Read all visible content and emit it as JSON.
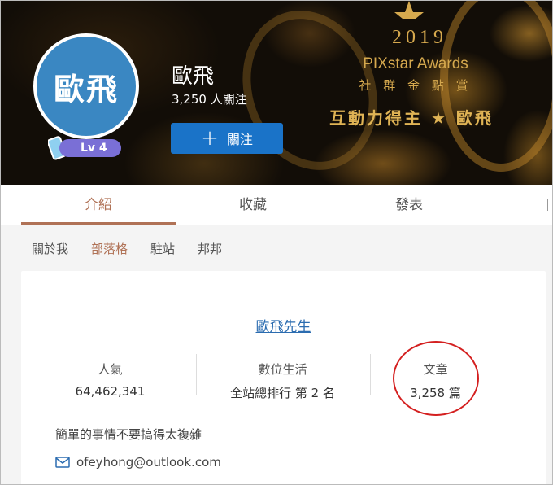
{
  "banner": {
    "award_year": "2019",
    "award_name": "PIXstar Awards",
    "award_category": "社 群 金 點 賞",
    "award_line": "互動力得主 ★ 歐飛"
  },
  "profile": {
    "avatar_text": "歐飛",
    "level": "Lv 4",
    "name": "歐飛",
    "followers": "3,250 人關注",
    "follow_label": "關注"
  },
  "tabs": [
    {
      "label": "介紹",
      "active": true
    },
    {
      "label": "收藏",
      "active": false
    },
    {
      "label": "發表",
      "active": false
    }
  ],
  "subnav": [
    {
      "label": "關於我",
      "active": false
    },
    {
      "label": "部落格",
      "active": true
    },
    {
      "label": "駐站",
      "active": false
    },
    {
      "label": "邦邦",
      "active": false
    }
  ],
  "card": {
    "site_title": "歐飛先生",
    "stats": [
      {
        "label": "人氣",
        "value": "64,462,341"
      },
      {
        "label": "數位生活",
        "value": "全站總排行 第 2 名"
      },
      {
        "label": "文章",
        "value": "3,258 篇"
      }
    ],
    "motto": "簡單的事情不要搞得太複雜",
    "email": "ofeyhong@outlook.com"
  },
  "colors": {
    "accent": "#b07256",
    "button": "#1a73c8",
    "link": "#2b6cb0",
    "gold": "#d6a94e",
    "highlight_circle": "#d42020"
  }
}
